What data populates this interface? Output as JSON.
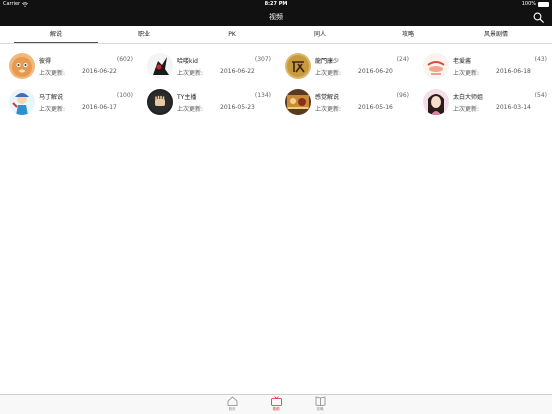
{
  "status_bar": {
    "carrier": "Carrier",
    "time": "8:27 PM",
    "battery": "100%"
  },
  "nav": {
    "title": "视频"
  },
  "tabs": [
    {
      "label": "解说",
      "active": true
    },
    {
      "label": "职业",
      "active": false
    },
    {
      "label": "PK",
      "active": false
    },
    {
      "label": "同人",
      "active": false
    },
    {
      "label": "攻略",
      "active": false
    },
    {
      "label": "风景剧情",
      "active": false
    }
  ],
  "update_label": "上次更新:",
  "cards": [
    {
      "name": "彼得",
      "count": "(602)",
      "date": "2016-06-22"
    },
    {
      "name": "哈喽kid",
      "count": "(307)",
      "date": "2016-06-22"
    },
    {
      "name": "龍門康少",
      "count": "(24)",
      "date": "2016-06-20"
    },
    {
      "name": "老爱酱",
      "count": "(43)",
      "date": "2016-06-18"
    },
    {
      "name": "马丁解说",
      "count": "(100)",
      "date": "2016-06-17"
    },
    {
      "name": "TY主播",
      "count": "(134)",
      "date": "2016-05-23"
    },
    {
      "name": "感觉解说",
      "count": "(96)",
      "date": "2016-05-16"
    },
    {
      "name": "太白大师姐",
      "count": "(54)",
      "date": "2016-03-14"
    }
  ],
  "bottom_tabs": [
    {
      "label": "首页",
      "icon": "home-icon",
      "active": false
    },
    {
      "label": "视频",
      "icon": "tv-icon",
      "active": true
    },
    {
      "label": "攻略",
      "icon": "book-icon",
      "active": false
    }
  ],
  "colors": {
    "bar": "#111111",
    "accent": "#d7262e"
  }
}
